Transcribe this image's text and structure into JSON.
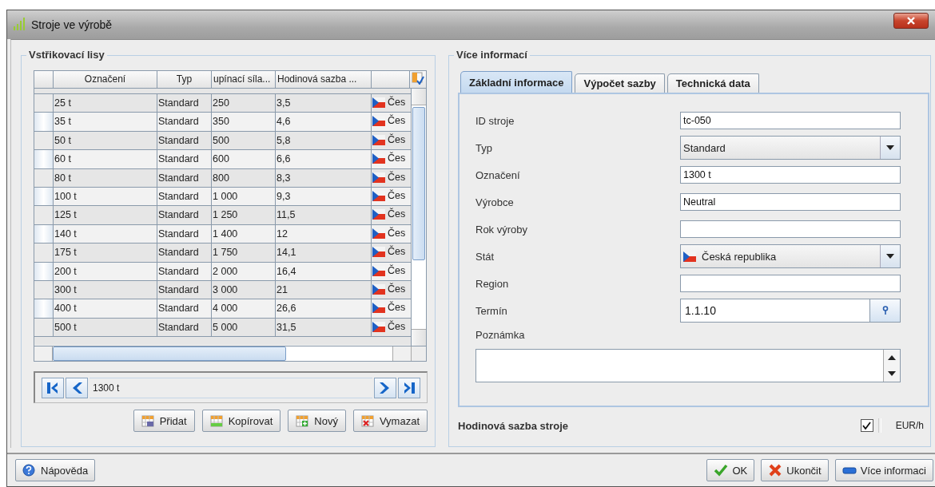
{
  "window": {
    "title": "Stroje ve výrobě"
  },
  "machines_panel": {
    "title": "Vstřikovací lisy",
    "table": {
      "columns": [
        "Označení",
        "Typ",
        "upínací síla...",
        "Hodinová sazba ..."
      ],
      "rows": [
        {
          "cells": [
            "25 t",
            "Standard",
            "250",
            "3,5"
          ],
          "country": "Čes"
        },
        {
          "cells": [
            "35 t",
            "Standard",
            "350",
            "4,6"
          ],
          "country": "Čes"
        },
        {
          "cells": [
            "50 t",
            "Standard",
            "500",
            "5,8"
          ],
          "country": "Čes"
        },
        {
          "cells": [
            "60 t",
            "Standard",
            "600",
            "6,6"
          ],
          "country": "Čes"
        },
        {
          "cells": [
            "80 t",
            "Standard",
            "800",
            "8,3"
          ],
          "country": "Čes"
        },
        {
          "cells": [
            "100 t",
            "Standard",
            "1 000",
            "9,3"
          ],
          "country": "Čes"
        },
        {
          "cells": [
            "125 t",
            "Standard",
            "1 250",
            "11,5"
          ],
          "country": "Čes"
        },
        {
          "cells": [
            "140 t",
            "Standard",
            "1 400",
            "12"
          ],
          "country": "Čes"
        },
        {
          "cells": [
            "175 t",
            "Standard",
            "1 750",
            "14,1"
          ],
          "country": "Čes"
        },
        {
          "cells": [
            "200 t",
            "Standard",
            "2 000",
            "16,4"
          ],
          "country": "Čes"
        },
        {
          "cells": [
            "300 t",
            "Standard",
            "3 000",
            "21"
          ],
          "country": "Čes"
        },
        {
          "cells": [
            "400 t",
            "Standard",
            "4 000",
            "26,6"
          ],
          "country": "Čes"
        },
        {
          "cells": [
            "500 t",
            "Standard",
            "5 000",
            "31,5"
          ],
          "country": "Čes"
        }
      ]
    },
    "navigator": {
      "value": "1300 t"
    },
    "buttons": [
      {
        "kind": "add",
        "label": "Přidat"
      },
      {
        "kind": "copy",
        "label": "Kopírovat"
      },
      {
        "kind": "new",
        "label": "Nový"
      },
      {
        "kind": "delete",
        "label": "Vymazat"
      }
    ]
  },
  "details_panel": {
    "title": "Více informací",
    "tabs": [
      {
        "label": "Základní informace",
        "selected": true
      },
      {
        "label": "Výpočet sazby",
        "selected": false
      },
      {
        "label": "Technická data",
        "selected": false
      }
    ],
    "fields": [
      {
        "kind": "text",
        "label": "ID stroje",
        "value": "tc-050"
      },
      {
        "kind": "combo",
        "label": "Typ",
        "value": "Standard"
      },
      {
        "kind": "text",
        "label": "Označení",
        "value": "1300 t"
      },
      {
        "kind": "text",
        "label": "Výrobce",
        "value": "Neutral"
      },
      {
        "kind": "text",
        "label": "Rok výroby"
      },
      {
        "kind": "country",
        "label": "Stát",
        "value": "Česká republika"
      },
      {
        "kind": "text",
        "label": "Region"
      },
      {
        "kind": "date",
        "label": "Termín",
        "value": "1.1.10"
      },
      {
        "kind": "textarea",
        "label": "Poznámka"
      }
    ],
    "rate": {
      "label": "Hodinová sazba stroje",
      "checked": true,
      "unit": "EUR/h"
    }
  },
  "footer": {
    "help": "Nápověda",
    "buttons": [
      {
        "kind": "ok",
        "label": "OK"
      },
      {
        "kind": "cancel",
        "label": "Ukončit"
      },
      {
        "kind": "info",
        "label": "Více informaci"
      }
    ]
  }
}
